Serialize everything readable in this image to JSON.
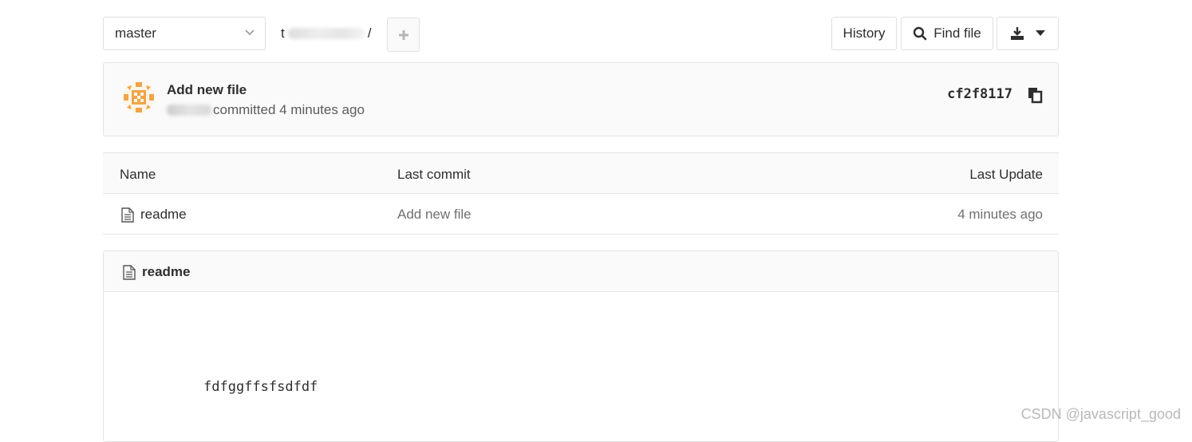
{
  "toolbar": {
    "branch": "master",
    "breadcrumb_start": "t",
    "breadcrumb_sep": "/",
    "history_label": "History",
    "find_file_label": "Find file"
  },
  "commit": {
    "title": "Add new file",
    "meta": "committed 4 minutes ago",
    "sha": "cf2f8117"
  },
  "table": {
    "headers": [
      "Name",
      "Last commit",
      "Last Update"
    ],
    "rows": [
      {
        "name": "readme",
        "last_commit": "Add new file",
        "last_update": "4 minutes ago"
      }
    ]
  },
  "readme": {
    "title": "readme",
    "content": "fdfggffsfsdfdf"
  },
  "watermark": "CSDN @javascript_good",
  "colors": {
    "border": "#e5e5e5",
    "panel_bg": "#fafafa",
    "avatar_orange": "#f0a54a",
    "muted": "#707070"
  }
}
